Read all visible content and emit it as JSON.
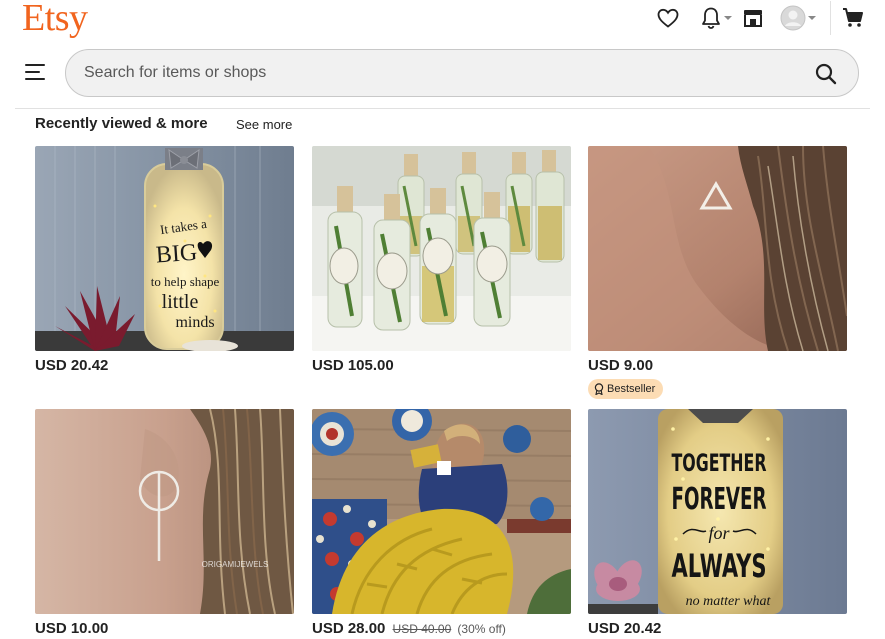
{
  "header": {
    "logo": "Etsy",
    "search": {
      "placeholder": "Search for items or shops"
    }
  },
  "section": {
    "title": "Recently viewed & more",
    "see_more": "See more"
  },
  "listings": [
    {
      "price": "USD 20.42",
      "image_caption": "It takes a BIG ♥ to help shape little minds"
    },
    {
      "price": "USD 105.00"
    },
    {
      "price": "USD 9.00",
      "badge": "Bestseller"
    },
    {
      "price": "USD 10.00",
      "watermark": "ORIGAMIJEWELS"
    },
    {
      "price": "USD 28.00",
      "original_price": "USD 40.00",
      "discount": "(30% off)"
    },
    {
      "price": "USD 20.42",
      "image_caption": "TOGETHER FOREVER for ALWAYS no matter what"
    }
  ],
  "colors": {
    "brand": "#F1641E",
    "badge_bg": "#fcdcb4"
  }
}
